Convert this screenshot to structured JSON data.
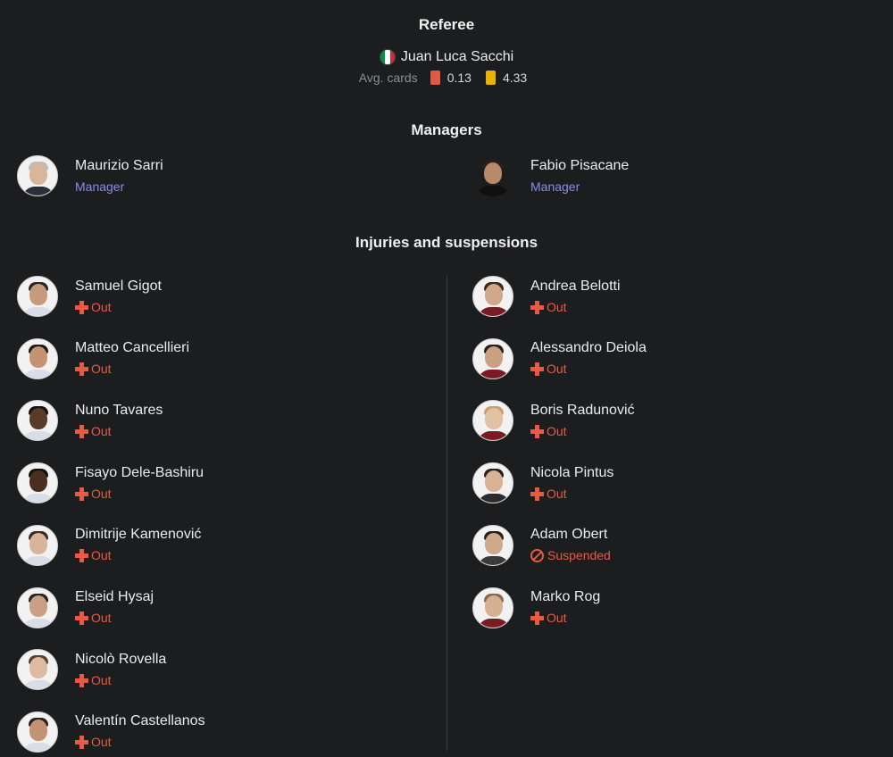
{
  "referee": {
    "title": "Referee",
    "name": "Juan Luca Sacchi",
    "avg_cards_label": "Avg. cards",
    "red_avg": "0.13",
    "yellow_avg": "4.33",
    "flag_colors": [
      "#009246",
      "#ffffff",
      "#ce2b37"
    ],
    "red_color": "#e05a45",
    "yellow_color": "#e8b400"
  },
  "managers": {
    "title": "Managers",
    "home": {
      "name": "Maurizio Sarri",
      "role": "Manager"
    },
    "away": {
      "name": "Fabio Pisacane",
      "role": "Manager"
    }
  },
  "injuries": {
    "title": "Injuries and suspensions",
    "home": [
      {
        "name": "Samuel Gigot",
        "status": "Out",
        "type": "injury"
      },
      {
        "name": "Matteo Cancellieri",
        "status": "Out",
        "type": "injury"
      },
      {
        "name": "Nuno Tavares",
        "status": "Out",
        "type": "injury"
      },
      {
        "name": "Fisayo Dele-Bashiru",
        "status": "Out",
        "type": "injury"
      },
      {
        "name": "Dimitrije Kamenović",
        "status": "Out",
        "type": "injury"
      },
      {
        "name": "Elseid Hysaj",
        "status": "Out",
        "type": "injury"
      },
      {
        "name": "Nicolò Rovella",
        "status": "Out",
        "type": "injury"
      },
      {
        "name": "Valentín Castellanos",
        "status": "Out",
        "type": "injury"
      }
    ],
    "away": [
      {
        "name": "Andrea Belotti",
        "status": "Out",
        "type": "injury"
      },
      {
        "name": "Alessandro Deiola",
        "status": "Out",
        "type": "injury"
      },
      {
        "name": "Boris Radunović",
        "status": "Out",
        "type": "injury"
      },
      {
        "name": "Nicola Pintus",
        "status": "Out",
        "type": "injury"
      },
      {
        "name": "Adam Obert",
        "status": "Suspended",
        "type": "suspension"
      },
      {
        "name": "Marko Rog",
        "status": "Out",
        "type": "injury"
      }
    ]
  },
  "colors": {
    "background": "#1c1d1e",
    "manager_role": "#8a8cf0",
    "status_out": "#e85a44"
  }
}
